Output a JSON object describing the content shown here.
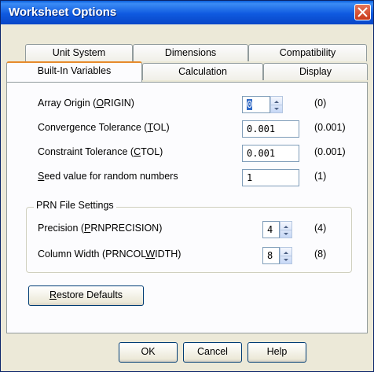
{
  "window": {
    "title": "Worksheet Options"
  },
  "tabs_row1": [
    {
      "label": "Unit System"
    },
    {
      "label": "Dimensions"
    },
    {
      "label": "Compatibility"
    }
  ],
  "tabs_row2": [
    {
      "label": "Built-In Variables",
      "active": true
    },
    {
      "label": "Calculation"
    },
    {
      "label": "Display"
    }
  ],
  "fields": {
    "origin": {
      "label_pre": "Array Origin  (",
      "mnemonic": "O",
      "label_post": "RIGIN)",
      "value": "0",
      "default": "(0)"
    },
    "tol": {
      "label_pre": "Convergence Tolerance  (",
      "mnemonic": "T",
      "label_post": "OL)",
      "value": "0.001",
      "default": "(0.001)"
    },
    "ctol": {
      "label_pre": "Constraint Tolerance  (",
      "mnemonic": "C",
      "label_post": "TOL)",
      "value": "0.001",
      "default": "(0.001)"
    },
    "seed": {
      "label_pre": "",
      "mnemonic": "S",
      "label_post": "eed value for random numbers",
      "value": "1",
      "default": "(1)"
    }
  },
  "prn": {
    "title": "PRN File Settings",
    "precision": {
      "label_pre": "Precision  (",
      "mnemonic": "P",
      "label_post": "RNPRECISION)",
      "value": "4",
      "default": "(4)"
    },
    "width": {
      "label_pre": "Column Width  (PRNCOL",
      "mnemonic": "W",
      "label_post": "IDTH)",
      "value": "8",
      "default": "(8)"
    }
  },
  "buttons": {
    "restore_mnemonic": "R",
    "restore_rest": "estore Defaults",
    "ok": "OK",
    "cancel": "Cancel",
    "help": "Help"
  },
  "colors": {
    "title_bar": "#0a5fdd",
    "dialog_bg": "#ece9d8",
    "active_tab_accent": "#e68b2c",
    "close_button": "#c8391a"
  }
}
